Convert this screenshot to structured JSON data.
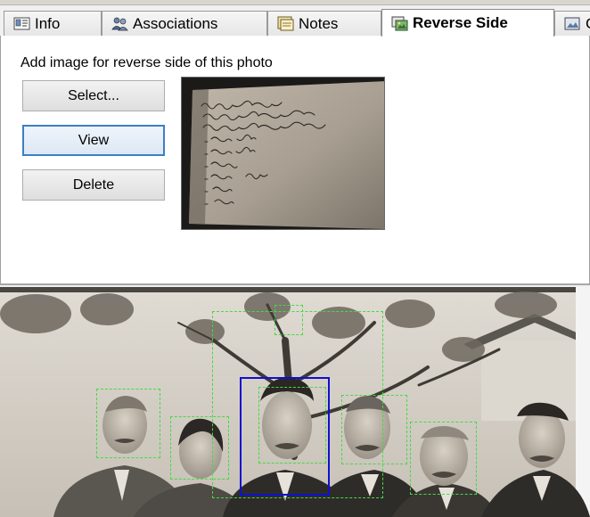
{
  "tabs": [
    {
      "label": "Info",
      "icon": "info-card-icon",
      "active": false
    },
    {
      "label": "Associations",
      "icon": "people-icon",
      "active": false
    },
    {
      "label": "Notes",
      "icon": "notes-icon",
      "active": false
    },
    {
      "label": "Reverse Side",
      "icon": "reverse-photo-icon",
      "active": true
    },
    {
      "label": "C",
      "icon": "photo-icon",
      "active": false
    }
  ],
  "reverse_side": {
    "instruction": "Add image for reverse side of this photo",
    "select_label": "Select...",
    "view_label": "View",
    "delete_label": "Delete"
  },
  "photo": {
    "face_tags": 9,
    "selected_face": 1
  },
  "colors": {
    "tab_border": "#9a9a9a",
    "panel_bg": "#ffffff",
    "view_focus": "#3c7fc4",
    "face_box": "#46d946",
    "face_box_selected": "#1010d0"
  }
}
